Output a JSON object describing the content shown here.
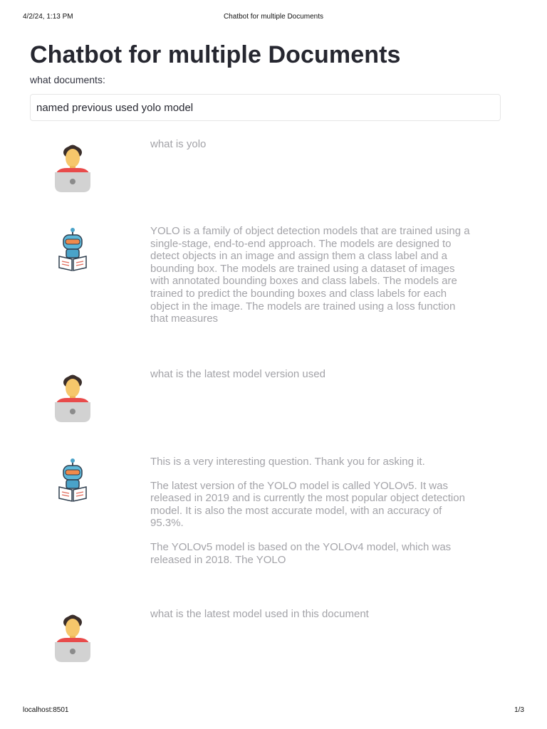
{
  "print": {
    "date": "4/2/24, 1:13 PM",
    "title": "Chatbot for multiple Documents",
    "url": "localhost:8501",
    "page": "1/3"
  },
  "app": {
    "title": "Chatbot for multiple Documents",
    "input_label": "what documents:",
    "input_value": "named previous used yolo model"
  },
  "messages": [
    {
      "role": "user",
      "avatar": "user-avatar-icon",
      "paragraphs": [
        "what is yolo"
      ]
    },
    {
      "role": "bot",
      "avatar": "robot-avatar-icon",
      "paragraphs": [
        "YOLO is a family of object detection models that are trained using a single-stage, end-to-end approach. The models are designed to detect objects in an image and assign them a class label and a bounding box. The models are trained using a dataset of images with annotated bounding boxes and class labels. The models are trained to predict the bounding boxes and class labels for each object in the image. The models are trained using a loss function that measures"
      ]
    },
    {
      "role": "user",
      "avatar": "user-avatar-icon",
      "paragraphs": [
        "what is the latest model version used"
      ]
    },
    {
      "role": "bot",
      "avatar": "robot-avatar-icon",
      "paragraphs": [
        "This is a very interesting question. Thank you for asking it.",
        "The latest version of the YOLO model is called YOLOv5. It was released in 2019 and is currently the most popular object detection model. It is also the most accurate model, with an accuracy of 95.3%.",
        "The YOLOv5 model is based on the YOLOv4 model, which was released in 2018. The YOLO"
      ]
    },
    {
      "role": "user",
      "avatar": "user-avatar-icon",
      "paragraphs": [
        "what is the latest model used in this document"
      ]
    }
  ]
}
